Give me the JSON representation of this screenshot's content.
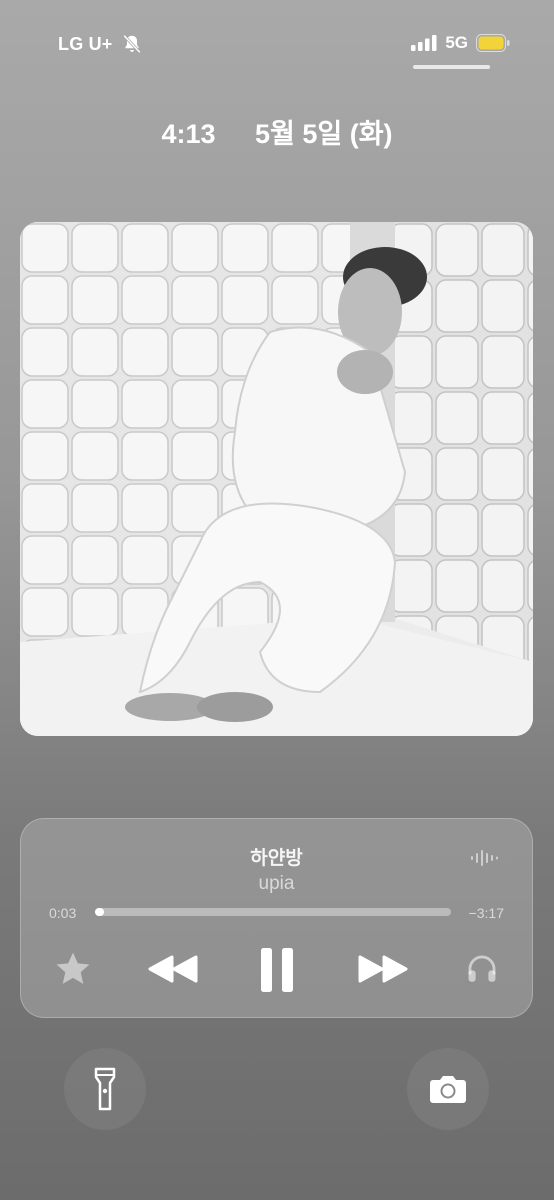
{
  "status_bar": {
    "carrier": "LG U+",
    "network": "5G",
    "icons": [
      "bell-slash-icon",
      "signal-icon",
      "battery-icon"
    ],
    "battery_color": "#f2d43a"
  },
  "lock_header": {
    "time": "4:13",
    "date": "5월 5일 (화)"
  },
  "now_playing": {
    "title": "하얀방",
    "artist": "upia",
    "elapsed": "0:03",
    "remaining": "−3:17",
    "progress_fraction": 0.016,
    "controls": [
      "star-icon",
      "rewind-icon",
      "pause-icon",
      "fast-forward-icon",
      "headphones-icon"
    ],
    "extra_icon": "waveform-icon"
  },
  "quick_actions": [
    "flashlight-icon",
    "camera-icon"
  ]
}
